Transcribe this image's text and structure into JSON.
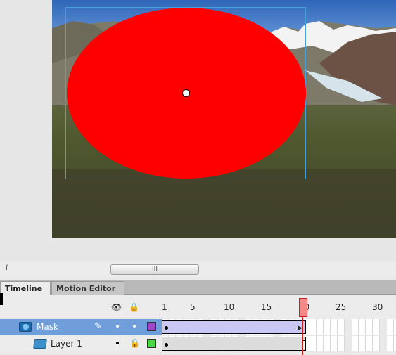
{
  "scrollbar": {
    "left_label": "f",
    "thumb_grip": "III"
  },
  "tabs": [
    {
      "label": "Timeline",
      "active": true
    },
    {
      "label": "Motion Editor",
      "active": false
    }
  ],
  "ruler": {
    "labels": [
      "1",
      "5",
      "10",
      "15",
      "20",
      "25",
      "30"
    ],
    "current_frame": 20
  },
  "layers": [
    {
      "name": "Mask",
      "type": "mask",
      "selected": true,
      "color": "#9e45c8"
    },
    {
      "name": "Layer 1",
      "type": "masked",
      "selected": false,
      "locked": true,
      "color": "#4cd64c"
    }
  ],
  "colors": {
    "shape_fill": "#ff0000",
    "selection_outline": "#44a0d8",
    "selected_layer": "#6f9edb",
    "playhead": "#d11a1a"
  },
  "icons": {
    "visibility": "eye-icon",
    "lock": "lock-icon",
    "outline": "outline-icon",
    "edit": "pencil-icon"
  }
}
